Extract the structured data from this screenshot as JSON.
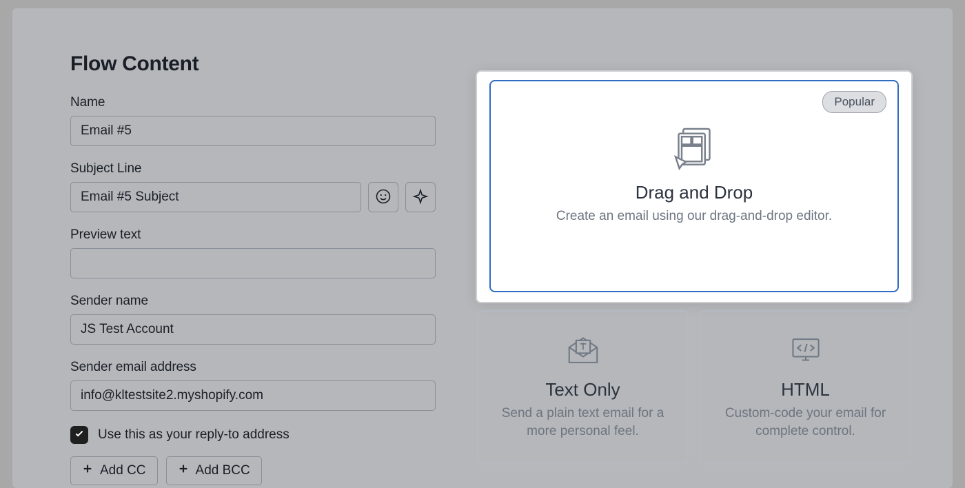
{
  "page_title": "Flow Content",
  "fields": {
    "name": {
      "label": "Name",
      "value": "Email #5"
    },
    "subject_line": {
      "label": "Subject Line",
      "value": "Email #5 Subject"
    },
    "preview_text": {
      "label": "Preview text",
      "value": ""
    },
    "sender_name": {
      "label": "Sender name",
      "value": "JS Test Account"
    },
    "sender_email": {
      "label": "Sender email address",
      "value": "info@kltestsite2.myshopify.com"
    }
  },
  "reply_to": {
    "checked": true,
    "label": "Use this as your reply-to address"
  },
  "buttons": {
    "add_cc": "Add CC",
    "add_bcc": "Add BCC"
  },
  "content_types": {
    "drag_drop": {
      "badge": "Popular",
      "title": "Drag and Drop",
      "desc": "Create an email using our drag-and-drop editor."
    },
    "text_only": {
      "title": "Text Only",
      "desc": "Send a plain text email for a more personal feel."
    },
    "html": {
      "title": "HTML",
      "desc": "Custom-code your email for complete control."
    }
  }
}
